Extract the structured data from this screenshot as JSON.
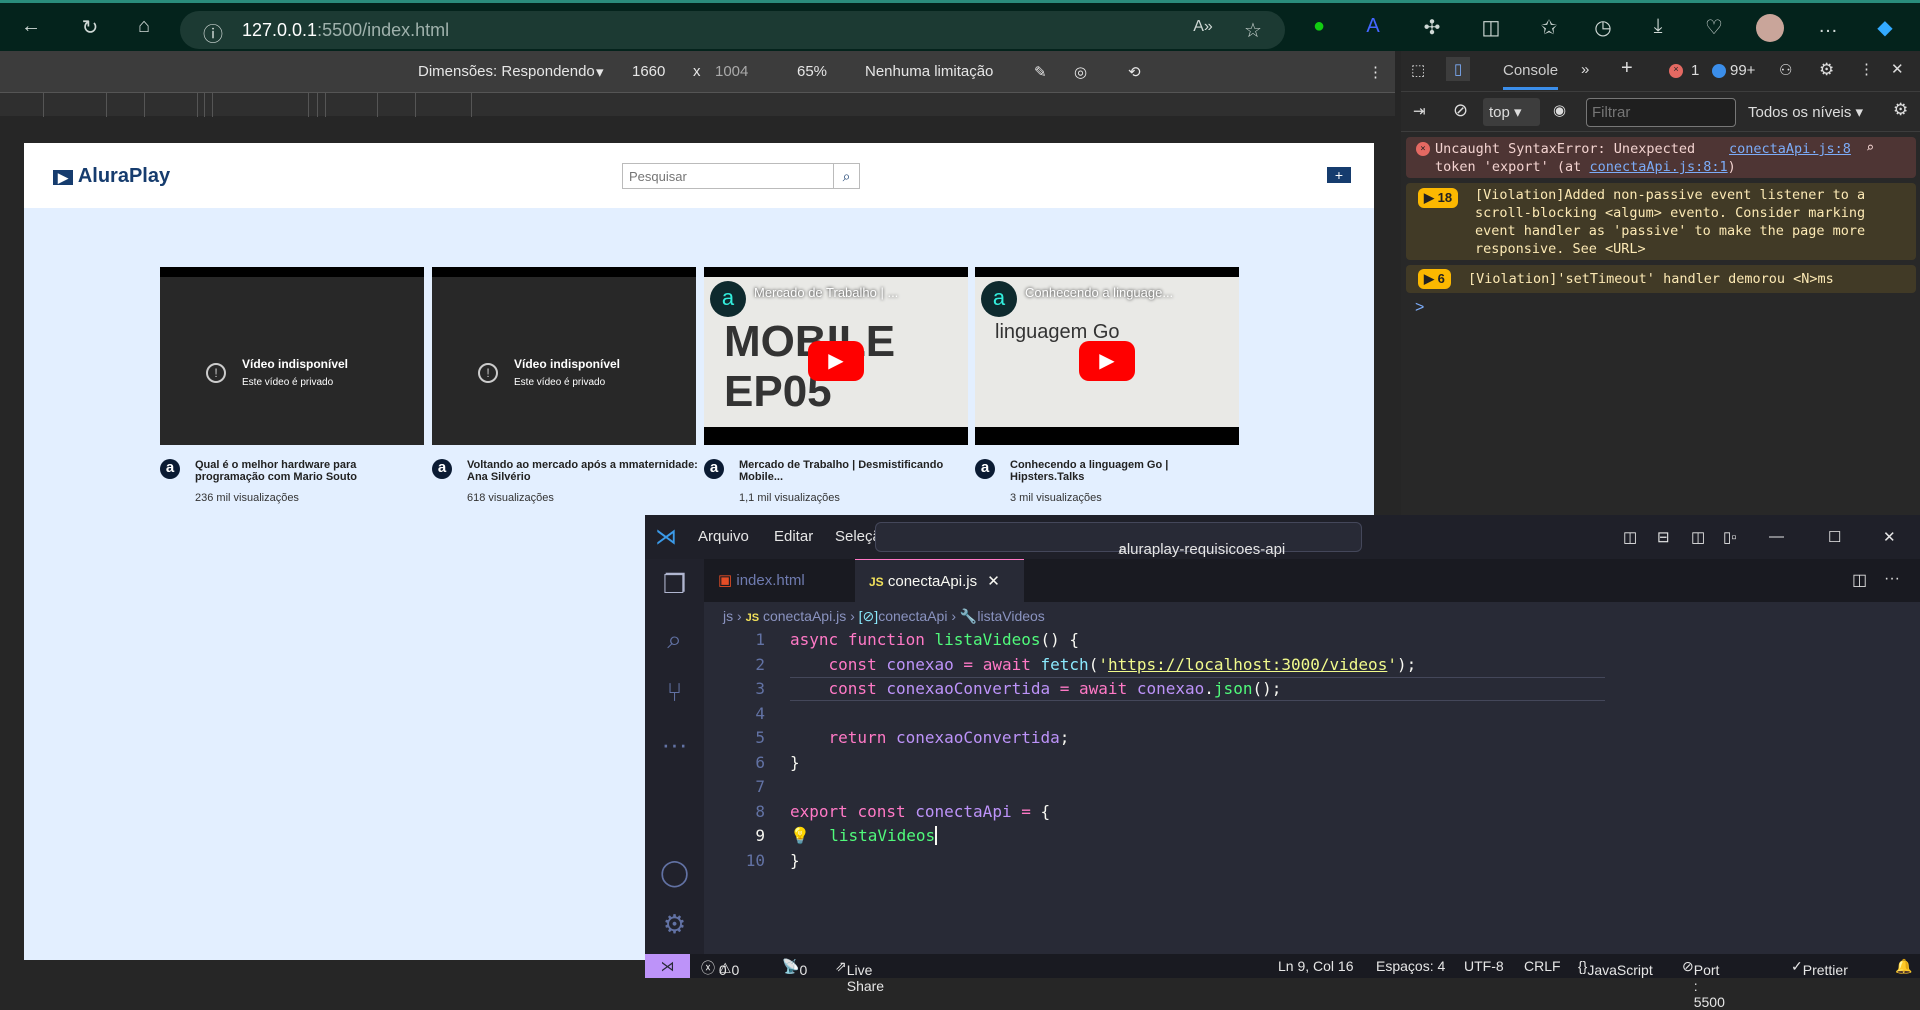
{
  "browser": {
    "url_host": "127.0.0.1",
    "url_path": ":5500/index.html"
  },
  "device_toolbar": {
    "dimensions": "Dimensões: Respondendo",
    "width": "1660",
    "x": "x",
    "height": "1004",
    "zoom": "65%",
    "throttle": "Nenhuma limitação"
  },
  "site": {
    "logo": "AluraPlay",
    "search_placeholder": "Pesquisar",
    "videos": [
      {
        "unavailable": "Vídeo indisponível",
        "private": "Este vídeo é privado",
        "title": "Qual é o melhor hardware para programação com Mario Souto",
        "views": "236 mil visualizações"
      },
      {
        "unavailable": "Vídeo indisponível",
        "private": "Este vídeo é privado",
        "title": "Voltando ao mercado após a mmaternidade: Ana Silvério",
        "views": "618 visualizações"
      },
      {
        "overlay": "Mercado de Trabalho | ...",
        "thumb_text": "MOBILE EP05",
        "title": "Mercado de Trabalho | Desmistificando Mobile...",
        "views": "1,1 mil visualizações"
      },
      {
        "overlay": "Conhecendo a linguage...",
        "thumb_text": "linguagem Go",
        "title": "Conhecendo a linguagem Go | Hipsters.Talks",
        "views": "3 mil visualizações"
      }
    ]
  },
  "devtools": {
    "tab": "Console",
    "errors": "1",
    "messages": "99+",
    "context": "top",
    "filter_placeholder": "Filtrar",
    "levels": "Todos os níveis",
    "error": {
      "text1": "Uncaught SyntaxError: Unexpected",
      "text2": "token 'export' (at ",
      "link_inline": "conectaApi.js:8:1",
      "text3": ")",
      "link": "conectaApi.js:8"
    },
    "violation1": {
      "count": "18",
      "text": "[Violation]Added non-passive event listener to a scroll-blocking <algum> evento. Consider marking event handler as 'passive' to make the page more responsive. See <URL>"
    },
    "violation2": {
      "count": "6",
      "text": "[Violation]'setTimeout' handler demorou <N>ms"
    },
    "prompt": ">"
  },
  "vscode": {
    "menu": [
      "Arquivo",
      "Editar",
      "Seleção",
      "···"
    ],
    "command_center": "aluraplay-requisicoes-api",
    "tabs": [
      {
        "label": "index.html",
        "icon": "html5-icon"
      },
      {
        "label": "conectaApi.js",
        "icon": "js-icon"
      }
    ],
    "breadcrumb": [
      "js",
      "conectaApi.js",
      "conectaApi",
      "listaVideos"
    ],
    "line_numbers": [
      "1",
      "2",
      "3",
      "4",
      "5",
      "6",
      "7",
      "8",
      "9",
      "10"
    ],
    "status": {
      "errors": "0",
      "warnings": "0",
      "ports": "0",
      "live_share": "Live Share",
      "position": "Ln 9, Col 16",
      "spaces": "Espaços: 4",
      "encoding": "UTF-8",
      "eol": "CRLF",
      "language": "JavaScript",
      "port": "Port : 5500",
      "prettier": "Prettier"
    },
    "accent": "#bd93f9"
  }
}
